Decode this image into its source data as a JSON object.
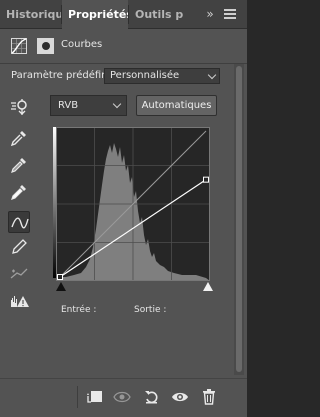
{
  "tabs": [
    {
      "label": "Historique",
      "active": false
    },
    {
      "label": "Propriétés",
      "active": true
    },
    {
      "label": "Outils préc",
      "active": false
    }
  ],
  "tab_overflow_label": "»",
  "adjustment": {
    "title": "Courbes"
  },
  "preset": {
    "label": "Paramètre prédéfini :",
    "value": "Personnalisée"
  },
  "channel": {
    "value": "RVB",
    "auto_label": "Automatiques"
  },
  "tools": [
    {
      "name": "on-image-adjust-icon",
      "selected": false
    },
    {
      "name": "black-point-eyedropper-icon",
      "selected": false
    },
    {
      "name": "gray-point-eyedropper-icon",
      "selected": false
    },
    {
      "name": "white-point-eyedropper-icon",
      "selected": false
    },
    {
      "name": "curve-edit-icon",
      "selected": true
    },
    {
      "name": "pencil-draw-icon",
      "selected": false
    },
    {
      "name": "smooth-curve-icon",
      "selected": false
    },
    {
      "name": "clipping-warning-icon",
      "selected": false
    }
  ],
  "curve": {
    "points": [
      [
        0,
        0
      ],
      [
        255,
        170
      ]
    ]
  },
  "io": {
    "input_label": "Entrée :",
    "output_label": "Sortie :"
  },
  "bottom_buttons": [
    "clip-to-layer-icon",
    "view-previous-state-icon",
    "reset-adjustments-icon",
    "toggle-visibility-icon",
    "delete-adjustment-icon"
  ],
  "colors": {
    "panel_bg": "#535353",
    "tab_bar_bg": "#424242",
    "histogram": "#8a8a8a",
    "curve_line": "#ffffff"
  }
}
